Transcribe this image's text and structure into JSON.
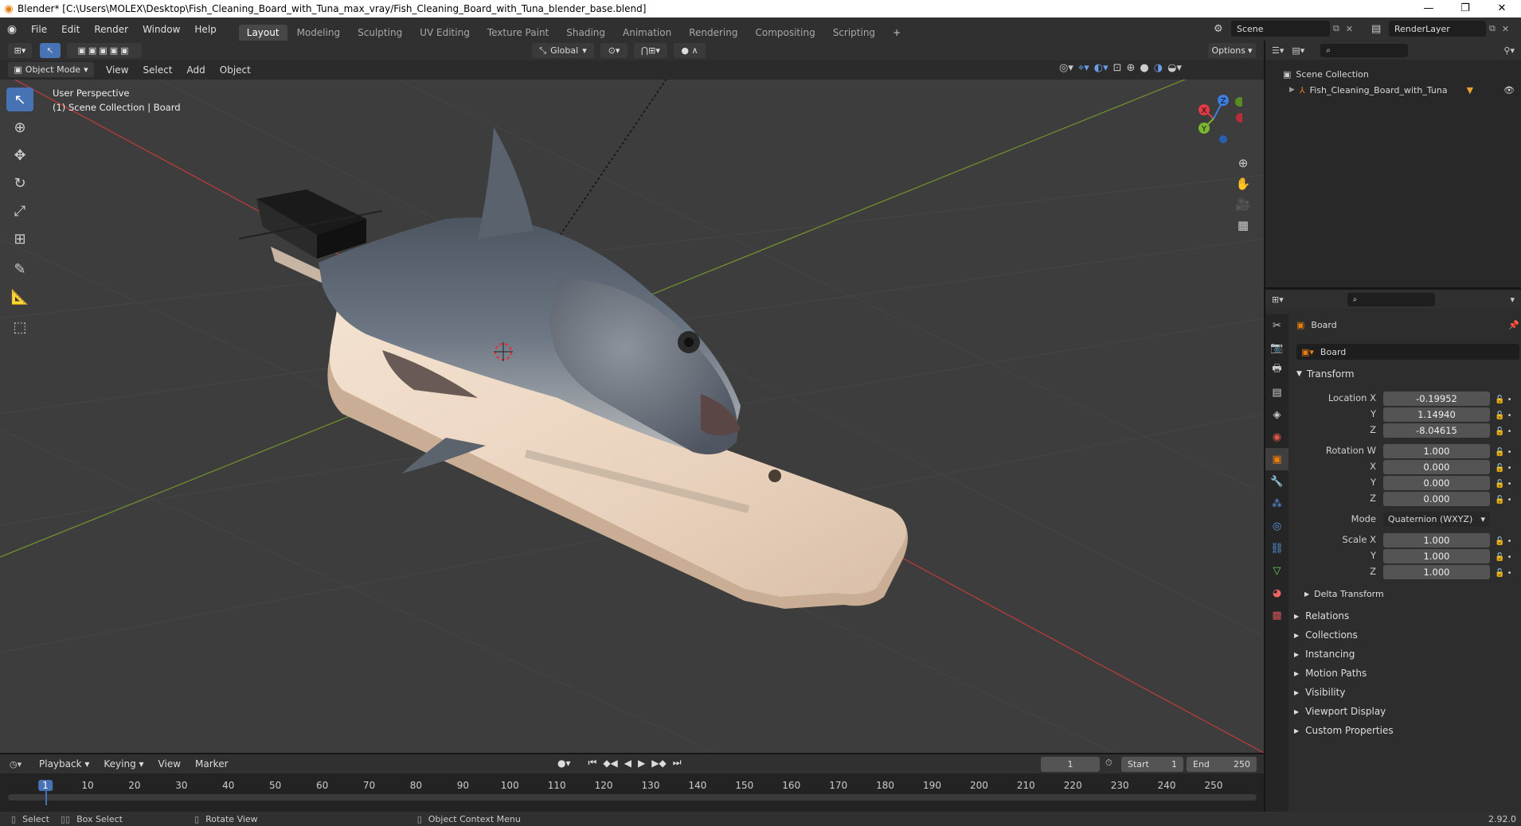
{
  "window": {
    "title": "Blender* [C:\\Users\\MOLEX\\Desktop\\Fish_Cleaning_Board_with_Tuna_max_vray/Fish_Cleaning_Board_with_Tuna_blender_base.blend]"
  },
  "topbar": {
    "menus": [
      "File",
      "Edit",
      "Render",
      "Window",
      "Help"
    ],
    "workspaces": [
      "Layout",
      "Modeling",
      "Sculpting",
      "UV Editing",
      "Texture Paint",
      "Shading",
      "Animation",
      "Rendering",
      "Compositing",
      "Scripting"
    ],
    "active_workspace": "Layout",
    "scene": "Scene",
    "view_layer": "RenderLayer"
  },
  "viewport_header": {
    "orientation": "Global",
    "options_label": "Options",
    "mode": "Object Mode",
    "menus": [
      "View",
      "Select",
      "Add",
      "Object"
    ]
  },
  "viewport": {
    "perspective": "User Perspective",
    "collection_info": "(1) Scene Collection | Board",
    "gizmo_axes": [
      "X",
      "Y",
      "Z"
    ]
  },
  "outliner": {
    "root": "Scene Collection",
    "items": [
      {
        "label": "Fish_Cleaning_Board_with_Tuna"
      }
    ]
  },
  "properties": {
    "object_name": "Board",
    "data_name": "Board",
    "transform_label": "Transform",
    "location": {
      "label": "Location X",
      "x": "-0.19952",
      "y": "1.14940",
      "z": "-8.04615"
    },
    "rotation": {
      "label": "Rotation W",
      "w": "1.000",
      "x": "0.000",
      "y": "0.000",
      "z": "0.000"
    },
    "mode_label": "Mode",
    "mode_value": "Quaternion (WXYZ)",
    "scale": {
      "label": "Scale X",
      "x": "1.000",
      "y": "1.000",
      "z": "1.000"
    },
    "axis_labels": {
      "y": "Y",
      "z": "Z",
      "x": "X"
    },
    "delta": "Delta Transform",
    "panels": [
      "Relations",
      "Collections",
      "Instancing",
      "Motion Paths",
      "Visibility",
      "Viewport Display",
      "Custom Properties"
    ]
  },
  "timeline": {
    "menus": [
      "Playback",
      "Keying",
      "View",
      "Marker"
    ],
    "current_frame": "1",
    "start_label": "Start",
    "start": "1",
    "end_label": "End",
    "end": "250",
    "ticks": [
      "1",
      "10",
      "20",
      "30",
      "40",
      "50",
      "60",
      "70",
      "80",
      "90",
      "100",
      "110",
      "120",
      "130",
      "140",
      "150",
      "160",
      "170",
      "180",
      "190",
      "200",
      "210",
      "220",
      "230",
      "240",
      "250"
    ]
  },
  "statusbar": {
    "select": "Select",
    "box_select": "Box Select",
    "rotate_view": "Rotate View",
    "context_menu": "Object Context Menu",
    "version": "2.92.0"
  },
  "colors": {
    "accent": "#4772b3",
    "x_axis": "#e23a45",
    "y_axis": "#7ab631",
    "z_axis": "#3d7de0"
  }
}
